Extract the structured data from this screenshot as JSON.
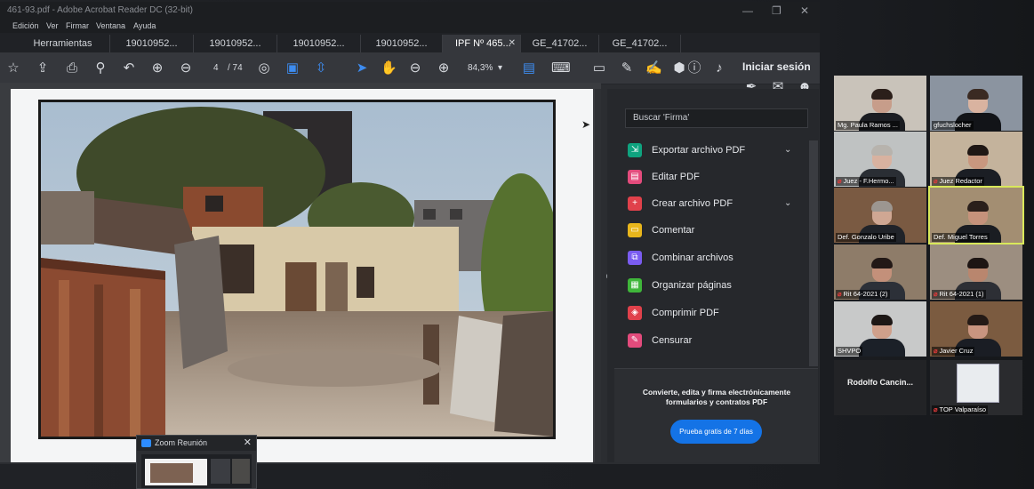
{
  "acrobat": {
    "title": "461-93.pdf - Adobe Acrobat Reader DC (32-bit)",
    "window_controls": [
      "—",
      "❐",
      "✕"
    ],
    "menu": [
      "Edición",
      "Ver",
      "Firmar",
      "Ventana",
      "Ayuda"
    ],
    "tabs_home": "Herramientas",
    "tabs": [
      "19010952...",
      "19010952...",
      "19010952...",
      "19010952...",
      "IPF Nº 465...",
      "GE_41702...",
      "GE_41702..."
    ],
    "tab_close": "✕",
    "toolbar": {
      "page_current": "4",
      "page_total": "/ 74",
      "zoom": "84,3%",
      "signin_label": "Iniciar sesión"
    },
    "tools_pane": {
      "search_placeholder": "Buscar 'Firma'",
      "items": [
        {
          "label": "Exportar archivo PDF",
          "icon": "export-pdf-icon",
          "color": "#0fa37f",
          "chevron": "⌄"
        },
        {
          "label": "Editar PDF",
          "icon": "edit-pdf-icon",
          "color": "#e34b7c",
          "chevron": ""
        },
        {
          "label": "Crear archivo PDF",
          "icon": "create-pdf-icon",
          "color": "#e0414b",
          "chevron": "⌄"
        },
        {
          "label": "Comentar",
          "icon": "comment-icon",
          "color": "#e8b61c",
          "chevron": ""
        },
        {
          "label": "Combinar archivos",
          "icon": "combine-files-icon",
          "color": "#7a5cf0",
          "chevron": ""
        },
        {
          "label": "Organizar páginas",
          "icon": "organize-pages-icon",
          "color": "#3fb63a",
          "chevron": ""
        },
        {
          "label": "Comprimir PDF",
          "icon": "compress-pdf-icon",
          "color": "#e0414b",
          "chevron": ""
        },
        {
          "label": "Censurar",
          "icon": "redact-icon",
          "color": "#e34b7c",
          "chevron": ""
        }
      ],
      "promo_text": "Convierte, edita y firma electrónicamente formularios y contratos PDF",
      "promo_button": "Prueba gratis de 7 días"
    },
    "zoom_mini_title": "Zoom Reunión",
    "zoom_mini_close": "✕"
  },
  "gallery": [
    {
      "name": "Mg. Paula Ramos ...",
      "mic_off": false,
      "bg": "#c9c3ba",
      "skin": "#c79d8a",
      "hair": "#2b1f1a",
      "shirt": "#1b1d22"
    },
    {
      "name": "gfuchslocher",
      "mic_off": false,
      "bg": "#8b94a0",
      "skin": "#d9b3a0",
      "hair": "#3a2a22",
      "shirt": "#121418"
    },
    {
      "name": "Juez - F.Hermo...",
      "mic_off": true,
      "bg": "#bfc2c2",
      "skin": "#d8b2a0",
      "hair": "#b7b3ad",
      "shirt": "#2a2e34"
    },
    {
      "name": "Juez Redactor",
      "mic_off": true,
      "bg": "#c4b39c",
      "skin": "#c8977f",
      "hair": "#1f1714",
      "shirt": "#1b1e24"
    },
    {
      "name": "Def. Gonzalo Uribe",
      "mic_off": false,
      "bg": "#7a5a42",
      "skin": "#cfa793",
      "hair": "#9c9690",
      "shirt": "#202329"
    },
    {
      "name": "Def. Miguel Torres",
      "mic_off": false,
      "bg": "#a38e72",
      "skin": "#c5927b",
      "hair": "#2a1f1b",
      "shirt": "#1a1d22"
    },
    {
      "name": "Rit 64-2021 (2)",
      "mic_off": true,
      "bg": "#8e7c69",
      "skin": "#c3907a",
      "hair": "#221816",
      "shirt": "#2c3038"
    },
    {
      "name": "Rit 64-2021 (1)",
      "mic_off": true,
      "bg": "#9c8e80",
      "skin": "#b9866e",
      "hair": "#1d1513",
      "shirt": "#2d2f35"
    },
    {
      "name": "SHVPO",
      "mic_off": false,
      "bg": "#c8c9c9",
      "skin": "#cfa08b",
      "hair": "#1d1715",
      "shirt": "#1b2028"
    },
    {
      "name": "Javier Cruz",
      "mic_off": true,
      "bg": "#7b5b40",
      "skin": "#c99580",
      "hair": "#241a16",
      "shirt": "#1a1d24"
    },
    {
      "name": "Rodolfo  Cancin...",
      "mic_off": true,
      "bg": "#222326",
      "skin": "",
      "hair": "",
      "shirt": ""
    },
    {
      "name": "TOP Valparaíso",
      "mic_off": true,
      "bg": "#2a2b2e",
      "skin": "",
      "hair": "",
      "shirt": ""
    }
  ]
}
